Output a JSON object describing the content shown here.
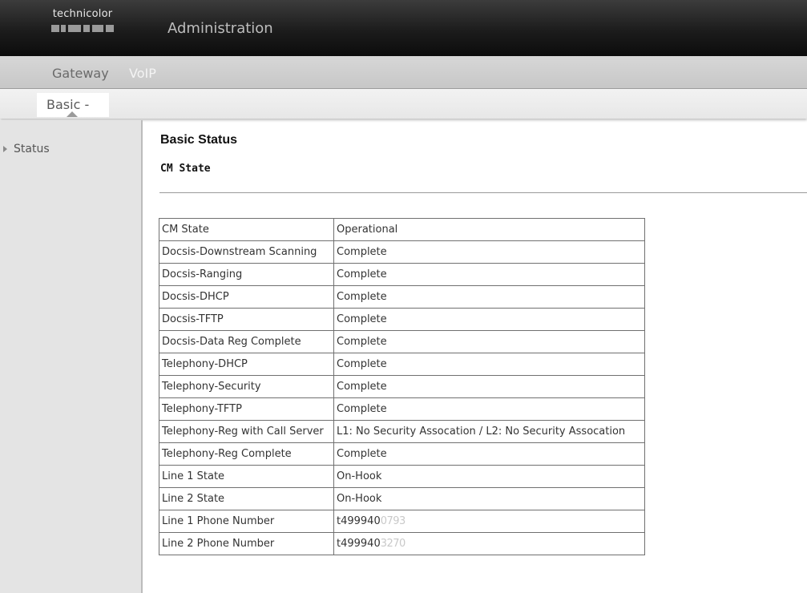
{
  "header": {
    "logo_text": "technicolor",
    "title": "Administration"
  },
  "menu": {
    "items": [
      {
        "label": "Gateway",
        "active": false
      },
      {
        "label": "VoIP",
        "active": true
      }
    ]
  },
  "subtabs": [
    {
      "label": "Basic -",
      "active": true
    }
  ],
  "sidebar": {
    "items": [
      {
        "label": "Status",
        "icon": "triangle-right-icon"
      }
    ]
  },
  "main": {
    "title": "Basic Status",
    "section_title": "CM State",
    "table": {
      "rows": [
        {
          "key": "CM State",
          "value": "Operational"
        },
        {
          "key": "Docsis-Downstream Scanning",
          "value": "Complete"
        },
        {
          "key": "Docsis-Ranging",
          "value": "Complete"
        },
        {
          "key": "Docsis-DHCP",
          "value": "Complete"
        },
        {
          "key": "Docsis-TFTP",
          "value": "Complete"
        },
        {
          "key": "Docsis-Data Reg Complete",
          "value": "Complete"
        },
        {
          "key": "Telephony-DHCP",
          "value": "Complete"
        },
        {
          "key": "Telephony-Security",
          "value": "Complete"
        },
        {
          "key": "Telephony-TFTP",
          "value": "Complete"
        },
        {
          "key": "Telephony-Reg with Call Server",
          "value": "L1: No Security Assocation / L2: No Security Assocation"
        },
        {
          "key": "Telephony-Reg Complete",
          "value": "Complete"
        },
        {
          "key": "Line 1 State",
          "value": "On-Hook"
        },
        {
          "key": "Line 2 State",
          "value": "On-Hook"
        },
        {
          "key": "Line 1 Phone Number",
          "value": "t499940",
          "value_redacted": "0793"
        },
        {
          "key": "Line 2 Phone Number",
          "value": "t499940",
          "value_redacted": "3270"
        }
      ]
    }
  },
  "colors": {
    "header_bg": "#1c1c1c",
    "menu_bg": "#c7c7c7",
    "sidebar_bg": "#e4e4e4",
    "table_border": "#707070"
  }
}
